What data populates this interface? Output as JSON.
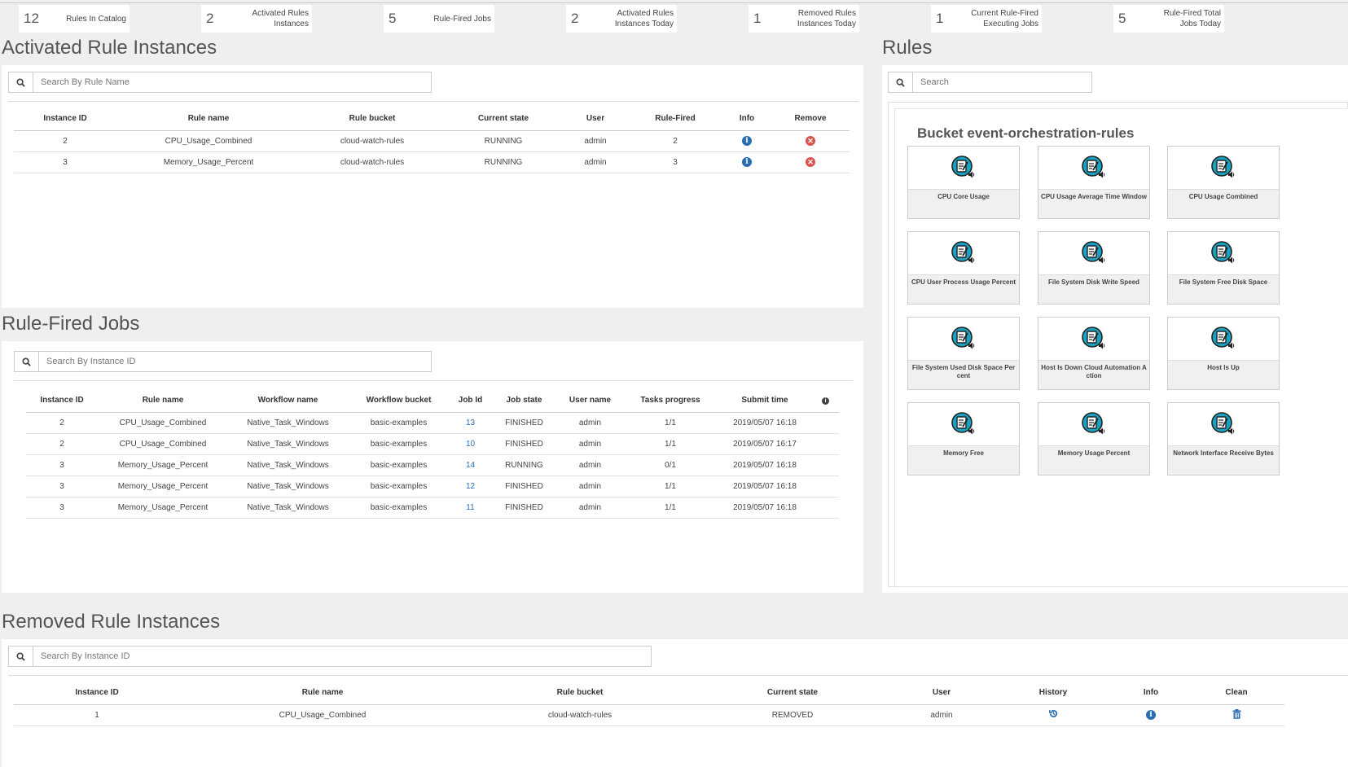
{
  "stats": [
    {
      "value": "12",
      "label": "Rules In Catalog"
    },
    {
      "value": "2",
      "label": "Activated Rules Instances"
    },
    {
      "value": "5",
      "label": "Rule-Fired Jobs"
    },
    {
      "value": "2",
      "label": "Activated Rules Instances Today"
    },
    {
      "value": "1",
      "label": "Removed Rules Instances Today"
    },
    {
      "value": "1",
      "label": "Current Rule-Fired Executing Jobs"
    },
    {
      "value": "5",
      "label": "Rule-Fired Total Jobs Today"
    }
  ],
  "activated": {
    "title": "Activated Rule Instances",
    "search_placeholder": "Search By Rule Name",
    "columns": [
      "Instance ID",
      "Rule name",
      "Rule bucket",
      "Current state",
      "User",
      "Rule-Fired",
      "Info",
      "Remove"
    ],
    "rows": [
      {
        "id": "2",
        "rule": "CPU_Usage_Combined",
        "bucket": "cloud-watch-rules",
        "state": "RUNNING",
        "user": "admin",
        "fired": "2"
      },
      {
        "id": "3",
        "rule": "Memory_Usage_Percent",
        "bucket": "cloud-watch-rules",
        "state": "RUNNING",
        "user": "admin",
        "fired": "3"
      }
    ]
  },
  "fired_jobs": {
    "title": "Rule-Fired Jobs",
    "search_placeholder": "Search By Instance ID",
    "columns": [
      "Instance ID",
      "Rule name",
      "Workflow name",
      "Workflow bucket",
      "Job Id",
      "Job state",
      "User name",
      "Tasks progress",
      "Submit time"
    ],
    "rows": [
      {
        "id": "2",
        "rule": "CPU_Usage_Combined",
        "workflow": "Native_Task_Windows",
        "wbucket": "basic-examples",
        "job": "13",
        "state": "FINISHED",
        "user": "admin",
        "progress": "1/1",
        "time": "2019/05/07 16:18"
      },
      {
        "id": "2",
        "rule": "CPU_Usage_Combined",
        "workflow": "Native_Task_Windows",
        "wbucket": "basic-examples",
        "job": "10",
        "state": "FINISHED",
        "user": "admin",
        "progress": "1/1",
        "time": "2019/05/07 16:17"
      },
      {
        "id": "3",
        "rule": "Memory_Usage_Percent",
        "workflow": "Native_Task_Windows",
        "wbucket": "basic-examples",
        "job": "14",
        "state": "RUNNING",
        "user": "admin",
        "progress": "0/1",
        "time": "2019/05/07 16:18"
      },
      {
        "id": "3",
        "rule": "Memory_Usage_Percent",
        "workflow": "Native_Task_Windows",
        "wbucket": "basic-examples",
        "job": "12",
        "state": "FINISHED",
        "user": "admin",
        "progress": "1/1",
        "time": "2019/05/07 16:18"
      },
      {
        "id": "3",
        "rule": "Memory_Usage_Percent",
        "workflow": "Native_Task_Windows",
        "wbucket": "basic-examples",
        "job": "11",
        "state": "FINISHED",
        "user": "admin",
        "progress": "1/1",
        "time": "2019/05/07 16:18"
      }
    ]
  },
  "rules": {
    "title": "Rules",
    "search_placeholder": "Search",
    "bucket_title": "Bucket event-orchestration-rules",
    "items": [
      "CPU Core Usage",
      "CPU Usage Average Time Window",
      "CPU Usage Combined",
      "CPU User Process Usage Percent",
      "File System Disk Write Speed",
      "File System Free Disk Space",
      "File System Used Disk Space Percent",
      "Host Is Down Cloud Automation Action",
      "Host Is Up",
      "Memory Free",
      "Memory Usage Percent",
      "Network Interface Receive Bytes"
    ]
  },
  "removed": {
    "title": "Removed Rule Instances",
    "search_placeholder": "Search By Instance ID",
    "columns": [
      "Instance ID",
      "Rule name",
      "Rule bucket",
      "Current state",
      "User",
      "History",
      "Info",
      "Clean"
    ],
    "rows": [
      {
        "id": "1",
        "rule": "CPU_Usage_Combined",
        "bucket": "cloud-watch-rules",
        "state": "REMOVED",
        "user": "admin"
      }
    ]
  },
  "icons": {
    "search": "search-icon",
    "info": "info-icon",
    "remove": "remove-icon",
    "history": "history-icon",
    "clean": "trash-icon",
    "rule": "rule-icon"
  },
  "colors": {
    "link": "#2a6db0",
    "remove": "#d9534f",
    "rule_icon": "#19a3c2"
  }
}
